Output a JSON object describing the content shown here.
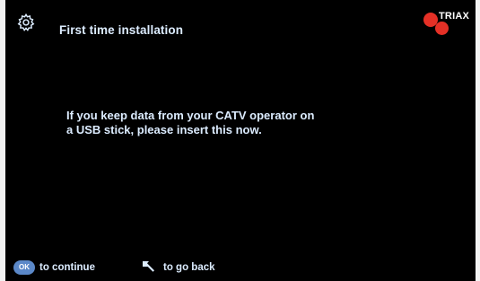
{
  "header": {
    "title": "First time installation",
    "settings_icon": "gear-icon"
  },
  "brand": {
    "name": "TRIAX",
    "color": "#e53026"
  },
  "message": {
    "lines": [
      "If you keep data from your CATV operator on",
      "a USB stick, please insert this now."
    ]
  },
  "footer": {
    "ok_key": "OK",
    "ok_label": "to continue",
    "back_icon": "back-arrow-icon",
    "back_label": "to go back"
  },
  "colors": {
    "background": "#000000",
    "text": "#dcecff",
    "ok_button": "#5b88c8"
  }
}
